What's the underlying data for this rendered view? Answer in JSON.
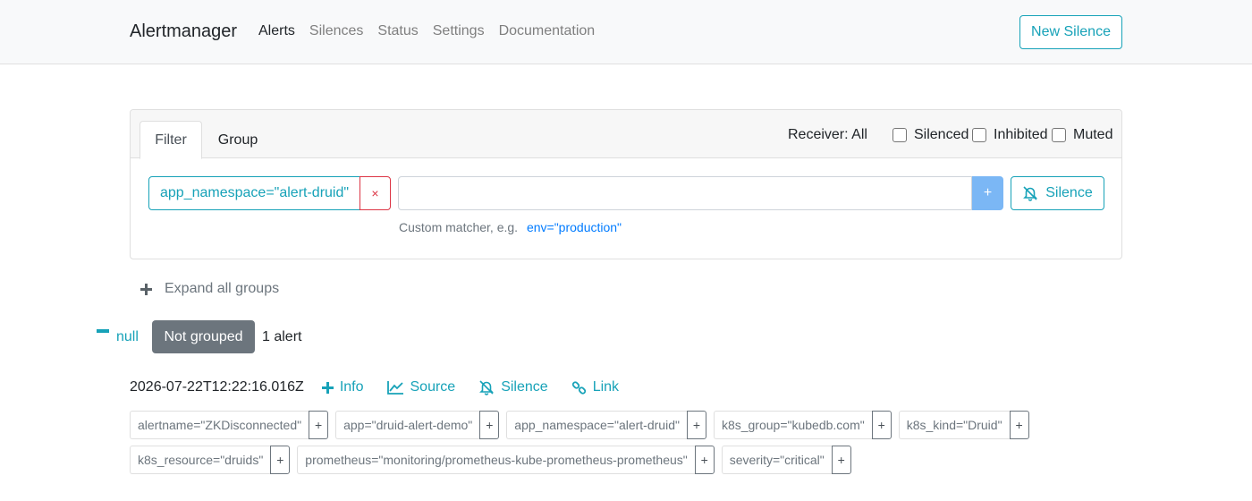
{
  "navbar": {
    "brand": "Alertmanager",
    "links": [
      {
        "label": "Alerts",
        "active": true
      },
      {
        "label": "Silences",
        "active": false
      },
      {
        "label": "Status",
        "active": false
      },
      {
        "label": "Settings",
        "active": false
      },
      {
        "label": "Documentation",
        "active": false
      }
    ],
    "new_silence_label": "New Silence"
  },
  "filter": {
    "tabs": [
      "Filter",
      "Group"
    ],
    "active_tab": "Filter",
    "receiver_label": "Receiver: All",
    "checkboxes": [
      {
        "label": "Silenced",
        "checked": false
      },
      {
        "label": "Inhibited",
        "checked": false
      },
      {
        "label": "Muted",
        "checked": false
      }
    ],
    "matcher": "app_namespace=\"alert-druid\"",
    "remove_glyph": "×",
    "custom_input_value": "",
    "add_glyph": "+",
    "silence_label": "Silence",
    "hint_text": "Custom matcher, e.g.",
    "hint_example": "env=\"production\""
  },
  "expand_all_label": "Expand all groups",
  "group": {
    "name": "null",
    "badge": "Not grouped",
    "count": "1 alert"
  },
  "alert": {
    "timestamp": "2026-07-22T12:22:16.016Z",
    "actions": {
      "info": "Info",
      "source": "Source",
      "silence": "Silence",
      "link": "Link"
    },
    "labels_row1": [
      "alertname=\"ZKDisconnected\"",
      "app=\"druid-alert-demo\"",
      "app_namespace=\"alert-druid\"",
      "k8s_group=\"kubedb.com\"",
      "k8s_kind=\"Druid\""
    ],
    "labels_row2": [
      "k8s_resource=\"druids\"",
      "prometheus=\"monitoring/prometheus-kube-prometheus-prometheus\"",
      "severity=\"critical\""
    ],
    "label_add_glyph": "+"
  },
  "colors": {
    "accent": "#17a2b8",
    "danger": "#dc3545",
    "badge": "#6c757d",
    "link": "#007bff"
  }
}
